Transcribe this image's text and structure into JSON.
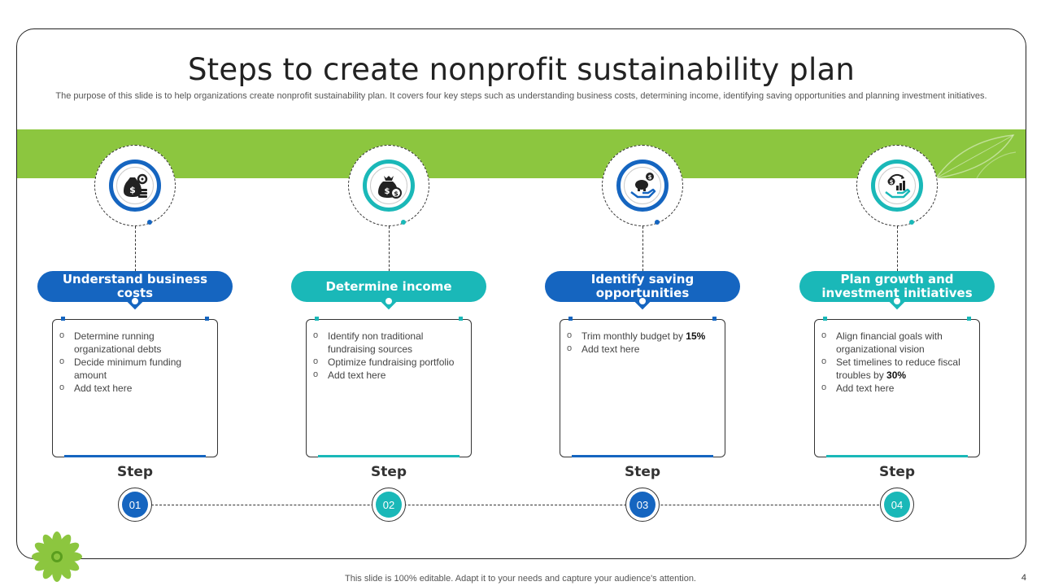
{
  "slide": {
    "title": "Steps to create nonprofit sustainability plan",
    "subtitle": "The purpose of this slide is to help organizations create nonprofit sustainability plan. It covers four key steps such as understanding business costs, determining income, identifying saving opportunities and planning investment initiatives.",
    "footer": "This slide is 100% editable. Adapt it to your needs and capture your audience's attention.",
    "page_number": "4"
  },
  "colors": {
    "green_band": "#8cc63f",
    "blue": "#1565c0",
    "teal": "#1ab8b8"
  },
  "steps": [
    {
      "heading": "Understand business costs",
      "icon": "money-bag-gears-icon",
      "step_label": "Step",
      "number": "01",
      "color": "blue",
      "bullets": [
        {
          "text": "Determine running organizational debts"
        },
        {
          "text": "Decide minimum funding amount"
        },
        {
          "text": "Add text here"
        }
      ]
    },
    {
      "heading": "Determine income",
      "icon": "money-bag-coin-icon",
      "step_label": "Step",
      "number": "02",
      "color": "teal",
      "bullets": [
        {
          "text": "Identify non traditional fundraising sources"
        },
        {
          "text": "Optimize fundraising portfolio"
        },
        {
          "text": "Add text here"
        }
      ]
    },
    {
      "heading": "Identify saving opportunities",
      "icon": "piggy-bank-hand-icon",
      "step_label": "Step",
      "number": "03",
      "color": "blue",
      "bullets": [
        {
          "text": "Trim monthly budget by ",
          "bold": "15%"
        },
        {
          "text": "Add text here"
        }
      ]
    },
    {
      "heading": "Plan growth and investment initiatives",
      "icon": "growth-chart-hand-icon",
      "step_label": "Step",
      "number": "04",
      "color": "teal",
      "bullets": [
        {
          "text": "Align financial goals with organizational vision"
        },
        {
          "text": "Set timelines to reduce fiscal troubles by ",
          "bold": "30%"
        },
        {
          "text": "Add text here"
        }
      ]
    }
  ]
}
